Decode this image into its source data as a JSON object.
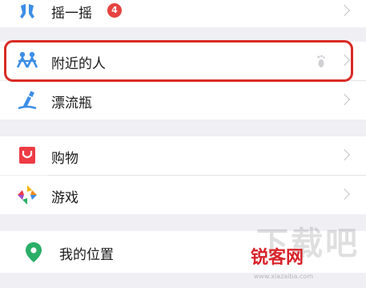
{
  "menu": {
    "shake": {
      "label": "摇一摇",
      "badge": "4"
    },
    "nearby": {
      "label": "附近的人"
    },
    "bottle": {
      "label": "漂流瓶"
    },
    "shopping": {
      "label": "购物"
    },
    "games": {
      "label": "游戏"
    },
    "location": {
      "label": "我的位置"
    }
  },
  "watermark": {
    "brand_text": "下载吧",
    "site_name": "锐客网",
    "url_text": "www.xiazaiba.com"
  },
  "colors": {
    "highlight": "#d92b25",
    "badge": "#e64340",
    "icon_blue": "#3d8ee6",
    "location_green": "#2aae67"
  }
}
